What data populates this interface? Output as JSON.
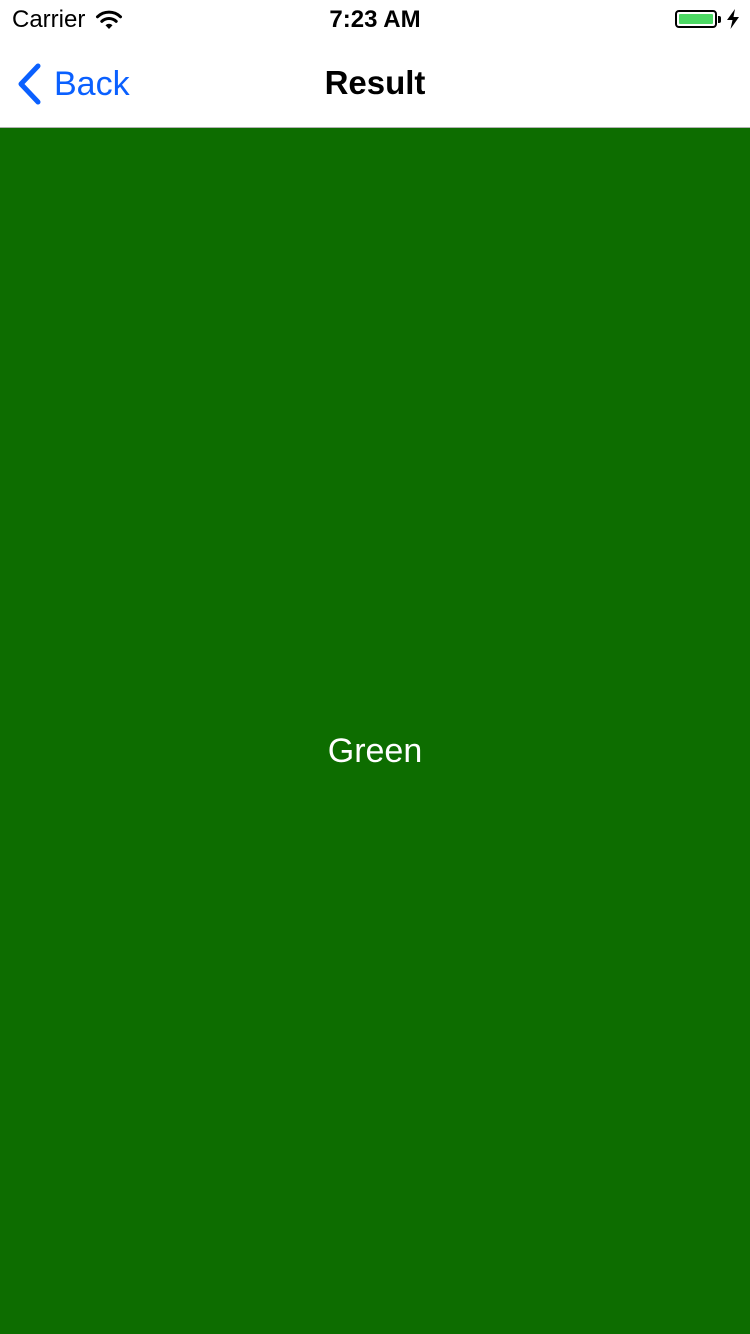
{
  "status_bar": {
    "carrier": "Carrier",
    "time": "7:23 AM",
    "battery_level": 1.0,
    "icons": [
      "wifi-icon",
      "battery-icon",
      "charging-bolt-icon"
    ]
  },
  "nav": {
    "back_label": "Back",
    "back_icon": "chevron-left-icon",
    "title": "Result"
  },
  "content": {
    "background_color": "#0d6d00",
    "label": "Green"
  },
  "colors": {
    "accent": "#0a60ff",
    "battery_fill": "#4cd964"
  }
}
